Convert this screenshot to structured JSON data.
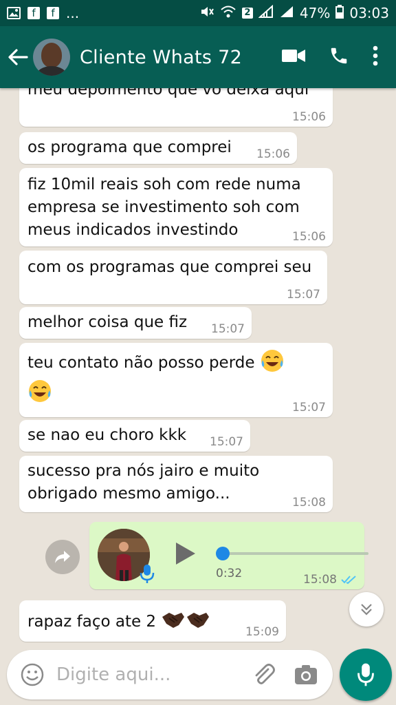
{
  "status_bar": {
    "overflow": "...",
    "sim": "2",
    "battery": "47%",
    "time": "03:03"
  },
  "header": {
    "contact_name": "Cliente Whats 72",
    "icons": [
      "back-arrow-icon",
      "video-call-icon",
      "phone-icon",
      "more-vert-icon"
    ]
  },
  "messages": [
    {
      "text": "meu depoimento que vo deixa aqui",
      "time": "15:06"
    },
    {
      "text": "os programa que comprei",
      "time": "15:06"
    },
    {
      "text": "fiz 10mil reais soh com rede numa\nempresa se investimento soh com\nmeus indicados investindo",
      "time": "15:06"
    },
    {
      "text": "com os programas que comprei seu",
      "time": "15:07"
    },
    {
      "text": "melhor coisa que fiz",
      "time": "15:07"
    },
    {
      "text": "teu contato não posso perde",
      "time": "15:07"
    },
    {
      "text": "se nao eu choro kkk",
      "time": "15:07"
    },
    {
      "text": "sucesso pra nós jairo e muito\nobrigado mesmo amigo...",
      "time": "15:08"
    },
    {
      "text": "rapaz faço ate 2",
      "time": "15:09"
    }
  ],
  "voice_note": {
    "duration": "0:32",
    "time": "15:08",
    "progress": 0
  },
  "composer": {
    "placeholder": "Digite aqui..."
  },
  "colors": {
    "appbar": "#075e54",
    "statusbar": "#054d44",
    "outgoing": "#dcf8c6",
    "fab": "#00897b",
    "read_ticks": "#4fc3f7"
  }
}
